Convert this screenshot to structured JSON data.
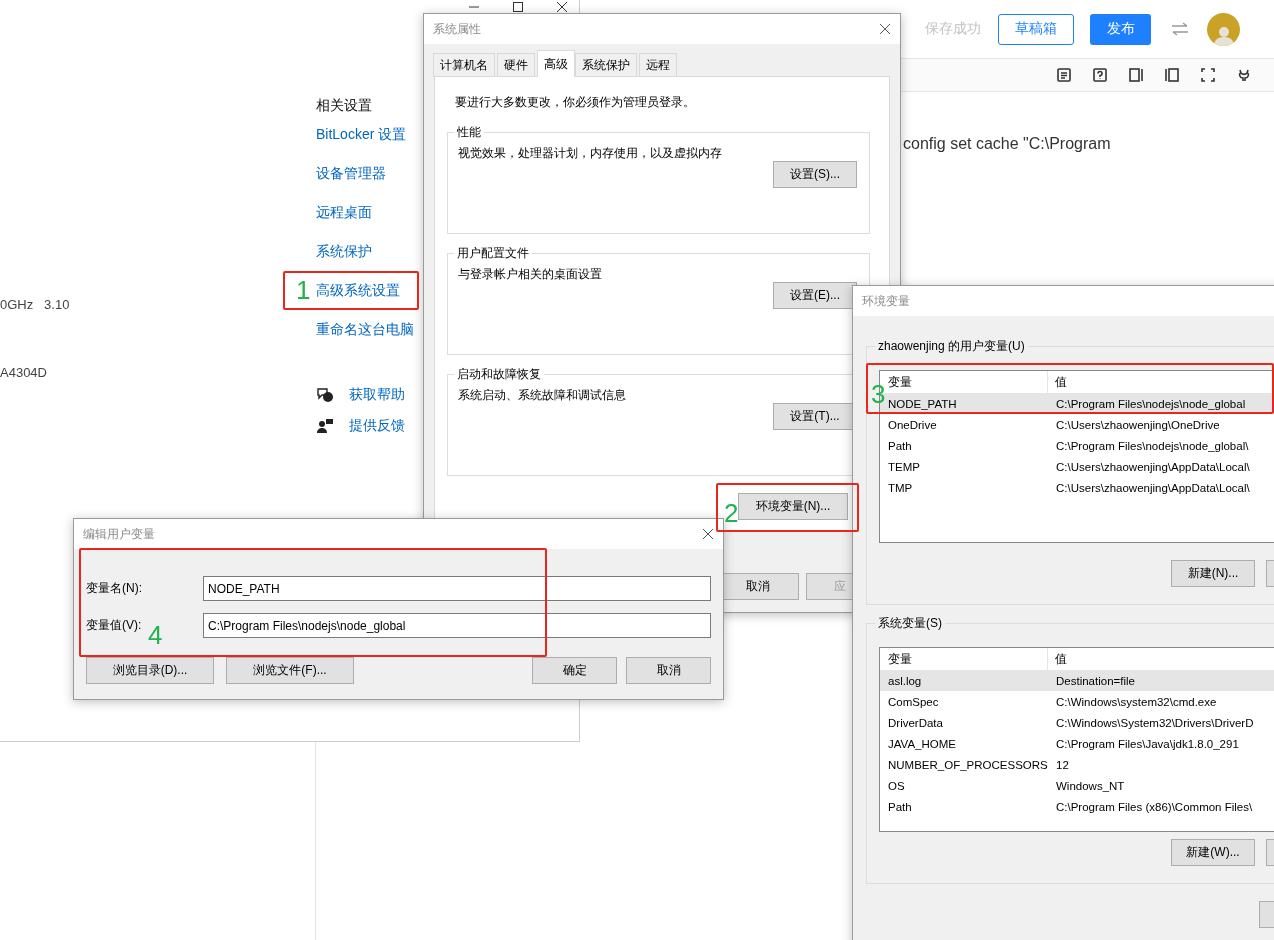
{
  "settings_window": {
    "info_fragments": [
      "0GHz   3.10",
      "A4304D"
    ],
    "related_title": "相关设置",
    "links": [
      "BitLocker 设置",
      "设备管理器",
      "远程桌面",
      "系统保护",
      "高级系统设置",
      "重命名这台电脑"
    ],
    "support_links": [
      {
        "kind": "help",
        "label": "获取帮助"
      },
      {
        "kind": "feedback",
        "label": "提供反馈"
      }
    ]
  },
  "editor": {
    "save_status": "保存成功",
    "draft_button": "草稿箱",
    "publish_button": "发布",
    "content_line": "config set cache \"C:\\Program"
  },
  "system_properties": {
    "title": "系统属性",
    "tabs": [
      {
        "label": "计算机名",
        "selected": false
      },
      {
        "label": "硬件",
        "selected": false
      },
      {
        "label": "高级",
        "selected": true
      },
      {
        "label": "系统保护",
        "selected": false
      },
      {
        "label": "远程",
        "selected": false
      }
    ],
    "notice": "要进行大多数更改，你必须作为管理员登录。",
    "groups": [
      {
        "title": "性能",
        "description": "视觉效果，处理器计划，内存使用，以及虚拟内存",
        "button": "设置(S)..."
      },
      {
        "title": "用户配置文件",
        "description": "与登录帐户相关的桌面设置",
        "button": "设置(E)..."
      },
      {
        "title": "启动和故障恢复",
        "description": "系统启动、系统故障和调试信息",
        "button": "设置(T)..."
      }
    ],
    "env_button": "环境变量(N)...",
    "buttons": [
      {
        "label": "取消",
        "disabled": false
      },
      {
        "label": "应",
        "disabled": true
      }
    ]
  },
  "environment_variables": {
    "title": "环境变量",
    "user_group": {
      "title": "zhaowenjing 的用户变量(U)",
      "columns": [
        "变量",
        "值"
      ],
      "rows": [
        {
          "name": "NODE_PATH",
          "value": "C:\\Program Files\\nodejs\\node_global",
          "selected": true
        },
        {
          "name": "OneDrive",
          "value": "C:\\Users\\zhaowenjing\\OneDrive",
          "selected": false
        },
        {
          "name": "Path",
          "value": "C:\\Program Files\\nodejs\\node_global\\",
          "selected": false
        },
        {
          "name": "TEMP",
          "value": "C:\\Users\\zhaowenjing\\AppData\\Local\\",
          "selected": false
        },
        {
          "name": "TMP",
          "value": "C:\\Users\\zhaowenjing\\AppData\\Local\\",
          "selected": false
        }
      ],
      "button": "新建(N)..."
    },
    "system_group": {
      "title": "系统变量(S)",
      "columns": [
        "变量",
        "值"
      ],
      "rows": [
        {
          "name": "asl.log",
          "value": "Destination=file",
          "selected": true
        },
        {
          "name": "ComSpec",
          "value": "C:\\Windows\\system32\\cmd.exe",
          "selected": false
        },
        {
          "name": "DriverData",
          "value": "C:\\Windows\\System32\\Drivers\\DriverD",
          "selected": false
        },
        {
          "name": "JAVA_HOME",
          "value": "C:\\Program Files\\Java\\jdk1.8.0_291",
          "selected": false
        },
        {
          "name": "NUMBER_OF_PROCESSORS",
          "value": "12",
          "selected": false
        },
        {
          "name": "OS",
          "value": "Windows_NT",
          "selected": false
        },
        {
          "name": "Path",
          "value": "C:\\Program Files (x86)\\Common Files\\",
          "selected": false
        }
      ],
      "button": "新建(W)..."
    }
  },
  "edit_user_variable": {
    "title": "编辑用户变量",
    "fields": [
      {
        "label": "变量名(N):",
        "value": "NODE_PATH"
      },
      {
        "label": "变量值(V):",
        "value": "C:\\Program Files\\nodejs\\node_global"
      }
    ],
    "left_buttons": [
      "浏览目录(D)...",
      "浏览文件(F)..."
    ],
    "right_buttons": [
      "确定",
      "取消"
    ]
  },
  "annotations": [
    {
      "number": "1"
    },
    {
      "number": "2"
    },
    {
      "number": "3"
    },
    {
      "number": "4"
    }
  ]
}
